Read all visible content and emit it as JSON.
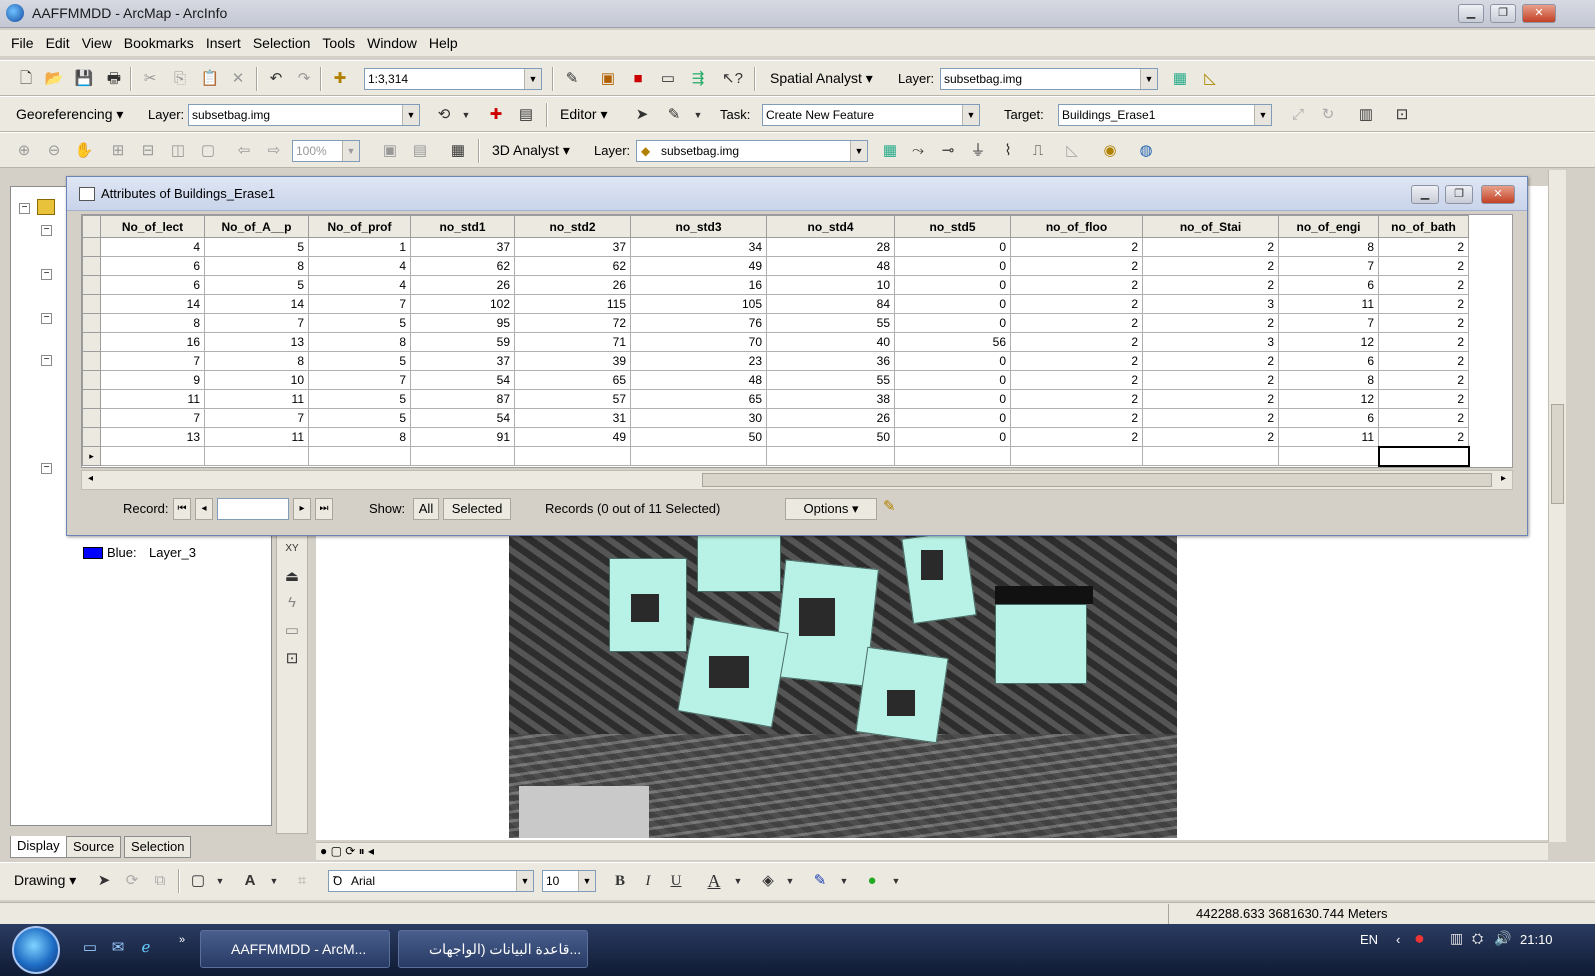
{
  "window": {
    "title": "AAFFMMDD - ArcMap - ArcInfo"
  },
  "menu": [
    "File",
    "Edit",
    "View",
    "Bookmarks",
    "Insert",
    "Selection",
    "Tools",
    "Window",
    "Help"
  ],
  "toolbar1": {
    "scale": "1:3,314",
    "spatial_analyst": "Spatial Analyst",
    "layer_label": "Layer:",
    "layer_value": "subsetbag.img"
  },
  "toolbar2": {
    "georeferencing": "Georeferencing",
    "layer_label": "Layer:",
    "layer_value": "subsetbag.img",
    "zoom": "100%",
    "editor": "Editor",
    "task_label": "Task:",
    "task_value": "Create New Feature",
    "target_label": "Target:",
    "target_value": "Buildings_Erase1"
  },
  "toolbar3": {
    "analyst_3d": "3D Analyst",
    "layer_label": "Layer:",
    "layer_value": "subsetbag.img",
    "zoom": "100%"
  },
  "toc": {
    "legend_label": "Blue:",
    "legend_layer": "Layer_3",
    "blue_color": "#0000ff",
    "tabs": [
      "Display",
      "Source",
      "Selection"
    ]
  },
  "attr": {
    "title": "Attributes of Buildings_Erase1",
    "columns": [
      "No_of_lect",
      "No_of_A__p",
      "No_of_prof",
      "no_std1",
      "no_std2",
      "no_std3",
      "no_std4",
      "no_std5",
      "no_of_floo",
      "no_of_Stai",
      "no_of_engi",
      "no_of_bath"
    ],
    "rows": [
      [
        "4",
        "5",
        "1",
        "37",
        "37",
        "34",
        "28",
        "0",
        "2",
        "2",
        "8",
        "2"
      ],
      [
        "6",
        "8",
        "4",
        "62",
        "62",
        "49",
        "48",
        "0",
        "2",
        "2",
        "7",
        "2"
      ],
      [
        "6",
        "5",
        "4",
        "26",
        "26",
        "16",
        "10",
        "0",
        "2",
        "2",
        "6",
        "2"
      ],
      [
        "14",
        "14",
        "7",
        "102",
        "115",
        "105",
        "84",
        "0",
        "2",
        "3",
        "11",
        "2"
      ],
      [
        "8",
        "7",
        "5",
        "95",
        "72",
        "76",
        "55",
        "0",
        "2",
        "2",
        "7",
        "2"
      ],
      [
        "16",
        "13",
        "8",
        "59",
        "71",
        "70",
        "40",
        "56",
        "2",
        "3",
        "12",
        "2"
      ],
      [
        "7",
        "8",
        "5",
        "37",
        "39",
        "23",
        "36",
        "0",
        "2",
        "2",
        "6",
        "2"
      ],
      [
        "9",
        "10",
        "7",
        "54",
        "65",
        "48",
        "55",
        "0",
        "2",
        "2",
        "8",
        "2"
      ],
      [
        "11",
        "11",
        "5",
        "87",
        "57",
        "65",
        "38",
        "0",
        "2",
        "2",
        "12",
        "2"
      ],
      [
        "7",
        "7",
        "5",
        "54",
        "31",
        "30",
        "26",
        "0",
        "2",
        "2",
        "6",
        "2"
      ],
      [
        "13",
        "11",
        "8",
        "91",
        "49",
        "50",
        "50",
        "0",
        "2",
        "2",
        "11",
        "2"
      ]
    ],
    "record_label": "Record:",
    "show_label": "Show:",
    "show_all": "All",
    "show_selected": "Selected",
    "records_status": "Records (0 out of 11 Selected)",
    "options": "Options"
  },
  "drawing": {
    "label": "Drawing",
    "font": "Arial",
    "size": "10",
    "bold": "B",
    "italic": "I",
    "underline": "U",
    "text_tool": "A",
    "font_color": "A"
  },
  "status": {
    "coords": "442288.633  3681630.744 Meters"
  },
  "taskbar": {
    "item1": "AAFFMMDD - ArcM...",
    "item2": "قاعدة البيانات (الواجهات...",
    "lang": "EN",
    "time": "21:10"
  }
}
